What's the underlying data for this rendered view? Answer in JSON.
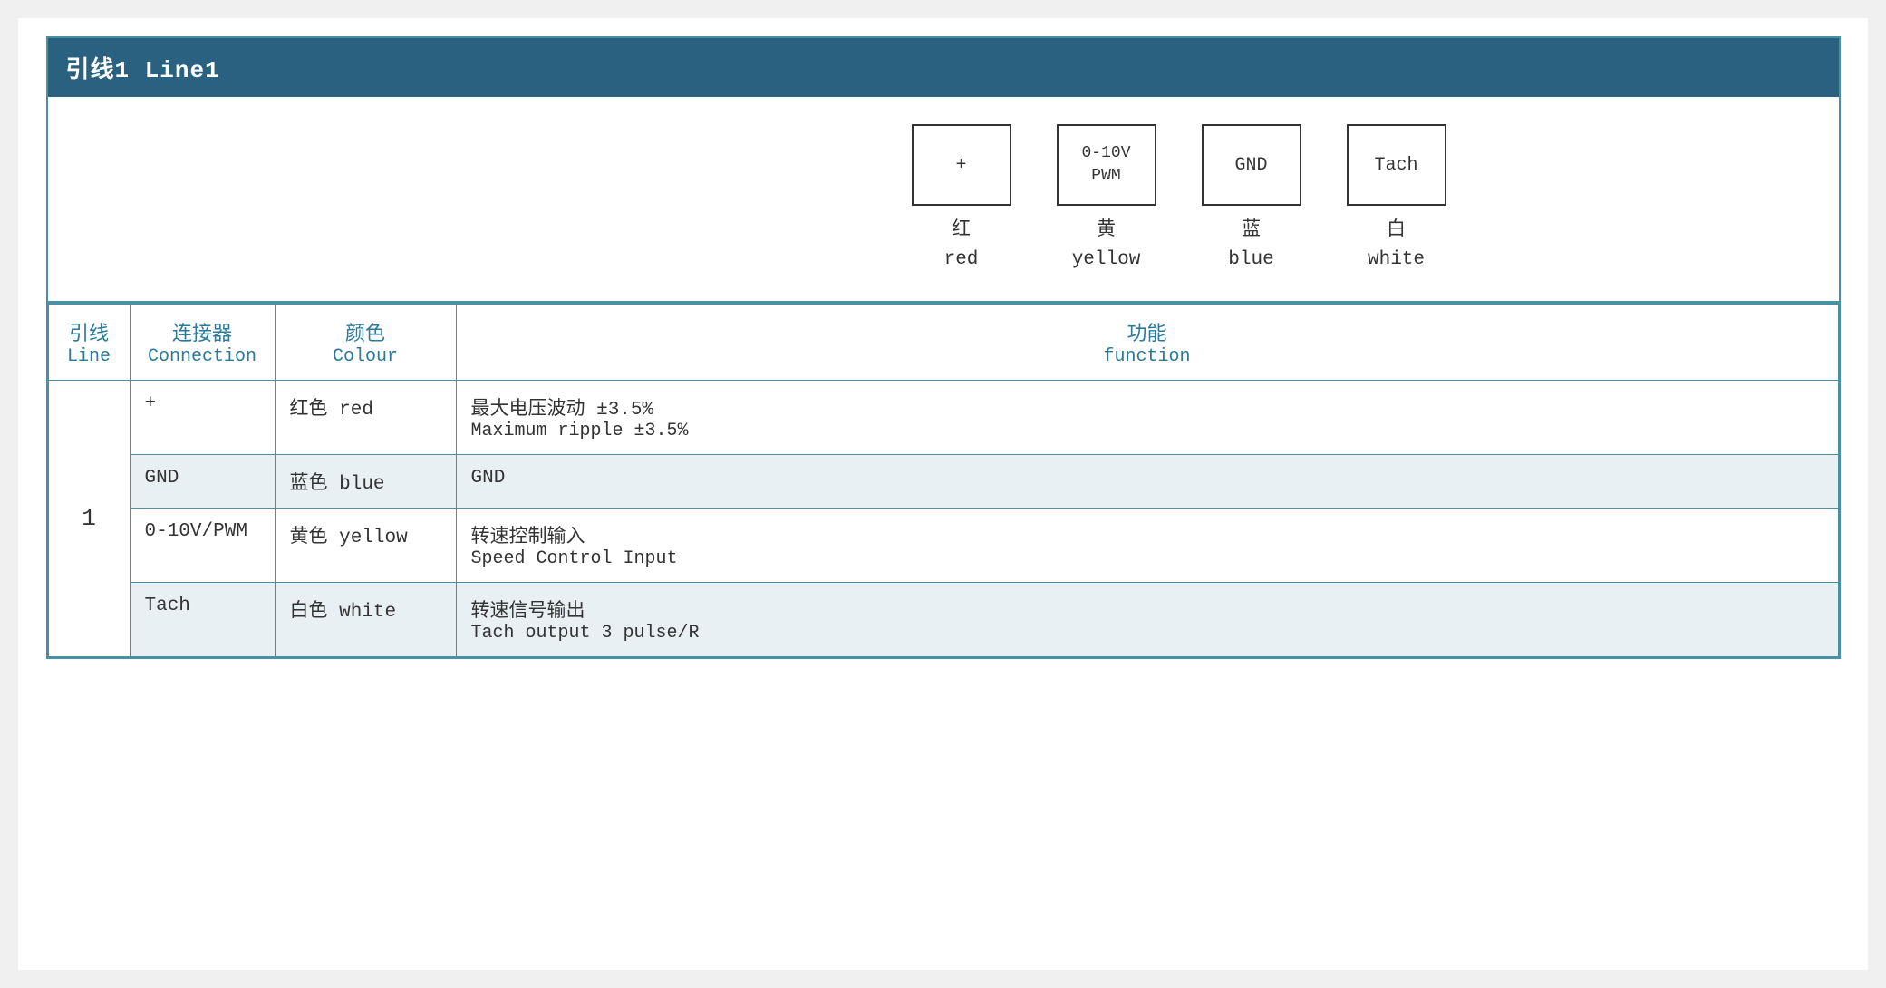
{
  "title": "引线1 Line1",
  "diagram": {
    "connectors": [
      {
        "symbol": "+",
        "zh": "红",
        "en": "red"
      },
      {
        "symbol": "0-10V\nPWM",
        "zh": "黄",
        "en": "yellow"
      },
      {
        "symbol": "GND",
        "zh": "蓝",
        "en": "blue"
      },
      {
        "symbol": "Tach",
        "zh": "白",
        "en": "white"
      }
    ]
  },
  "table": {
    "headers": [
      {
        "zh": "引线",
        "en": "Line"
      },
      {
        "zh": "连接器",
        "en": "Connection"
      },
      {
        "zh": "颜色",
        "en": "Colour"
      },
      {
        "zh": "功能",
        "en": "function"
      }
    ],
    "rows": [
      {
        "line": "1",
        "rowspan": 4,
        "connection": "+",
        "color_zh": "红色",
        "color_en": "red",
        "func_zh": "最大电压波动 ±3.5%",
        "func_en": "Maximum ripple ±3.5%",
        "alt": false
      },
      {
        "line": "",
        "connection": "GND",
        "color_zh": "蓝色",
        "color_en": "blue",
        "func_zh": "GND",
        "func_en": "",
        "alt": true
      },
      {
        "line": "",
        "connection": "0-10V/PWM",
        "color_zh": "黄色",
        "color_en": "yellow",
        "func_zh": "转速控制输入",
        "func_en": "Speed Control Input",
        "alt": false
      },
      {
        "line": "",
        "connection": "Tach",
        "color_zh": "白色",
        "color_en": "white",
        "func_zh": "转速信号输出",
        "func_en": "Tach output 3 pulse/R",
        "alt": true
      }
    ]
  }
}
